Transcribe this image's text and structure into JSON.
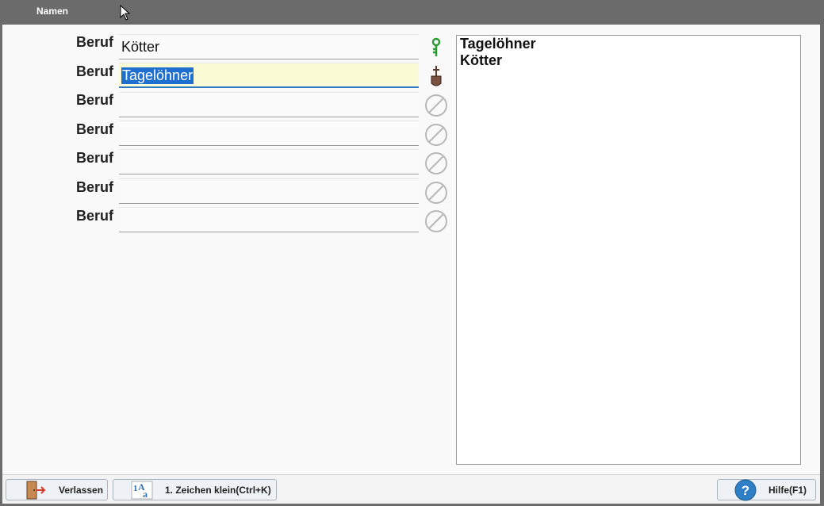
{
  "window": {
    "title": "Namen"
  },
  "form": {
    "rows": [
      {
        "label": "Beruf",
        "value": "Kötter",
        "icon": "green-key-icon"
      },
      {
        "label": "Beruf",
        "value": "Tagelöhner",
        "icon": "shovel-icon"
      },
      {
        "label": "Beruf",
        "value": "",
        "icon": "disabled-icon"
      },
      {
        "label": "Beruf",
        "value": "",
        "icon": "disabled-icon"
      },
      {
        "label": "Beruf",
        "value": "",
        "icon": "disabled-icon"
      },
      {
        "label": "Beruf",
        "value": "",
        "icon": "disabled-icon"
      },
      {
        "label": "Beruf",
        "value": "",
        "icon": "disabled-icon"
      }
    ]
  },
  "preview": {
    "lines": [
      "Tagelöhner",
      "Kötter"
    ]
  },
  "footer": {
    "exit_label": "Verlassen",
    "lowercase_label": "1. Zeichen klein(Ctrl+K)",
    "help_label": "Hilfe(F1)"
  }
}
